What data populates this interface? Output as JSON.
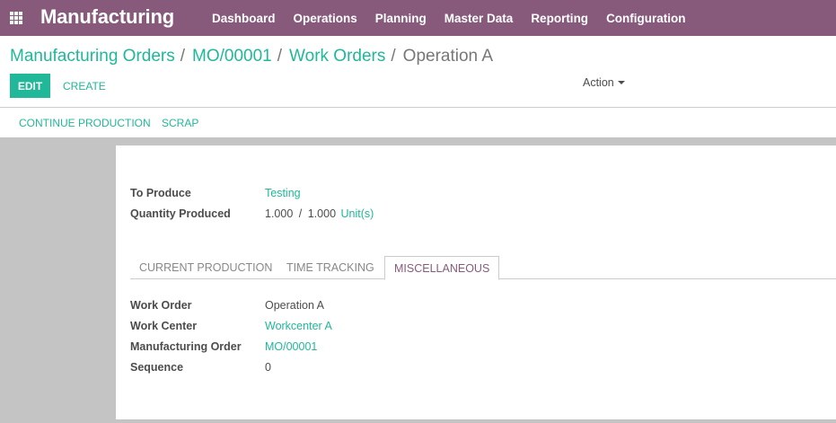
{
  "app": {
    "title": "Manufacturing"
  },
  "menu": [
    "Dashboard",
    "Operations",
    "Planning",
    "Master Data",
    "Reporting",
    "Configuration"
  ],
  "breadcrumb": {
    "items": [
      "Manufacturing Orders",
      "MO/00001",
      "Work Orders"
    ],
    "current": "Operation A",
    "separator": "/"
  },
  "toolbar": {
    "edit_label": "EDIT",
    "create_label": "CREATE",
    "action_label": "Action"
  },
  "statusbar": {
    "continue_label": "CONTINUE PRODUCTION",
    "scrap_label": "SCRAP"
  },
  "form": {
    "to_produce_label": "To Produce",
    "to_produce_value": "Testing",
    "qty_label": "Quantity Produced",
    "qty_done": "1.000",
    "qty_sep": "/",
    "qty_total": "1.000",
    "qty_uom": "Unit(s)"
  },
  "tabs": [
    "CURRENT PRODUCTION",
    "TIME TRACKING",
    "MISCELLANEOUS"
  ],
  "active_tab": "MISCELLANEOUS",
  "misc": {
    "work_order_label": "Work Order",
    "work_order_value": "Operation A",
    "work_center_label": "Work Center",
    "work_center_value": "Workcenter A",
    "mo_label": "Manufacturing Order",
    "mo_value": "MO/00001",
    "sequence_label": "Sequence",
    "sequence_value": "0"
  },
  "colors": {
    "brand": "#875a7b",
    "accent": "#21b799",
    "background": "#c4c4c4"
  }
}
